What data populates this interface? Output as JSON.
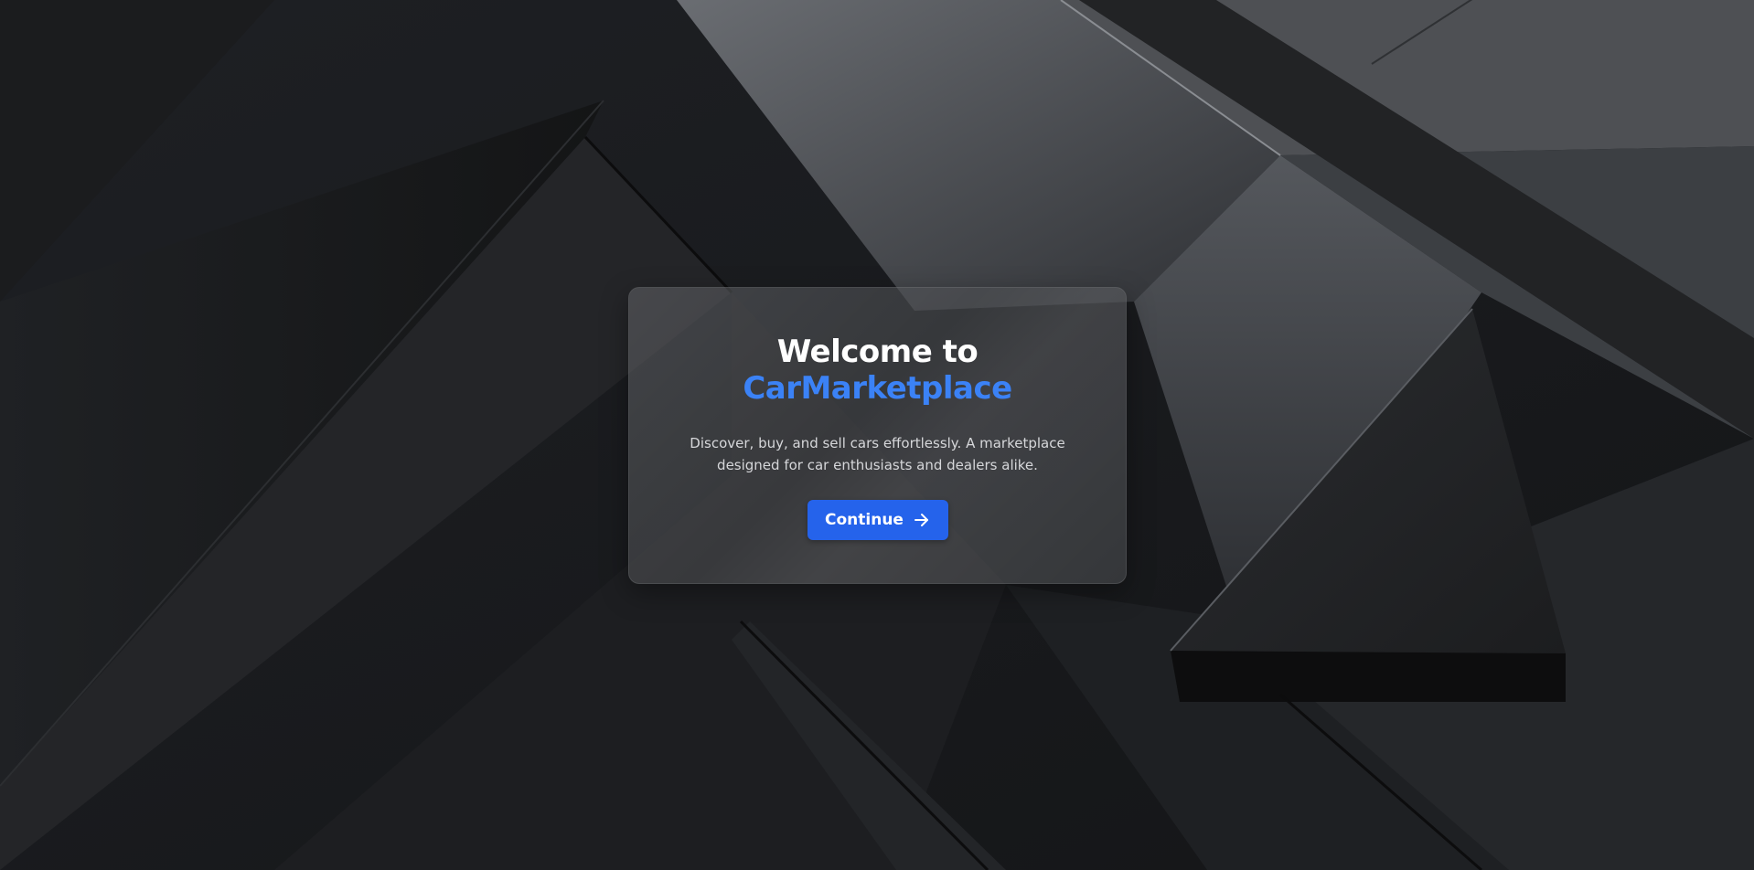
{
  "welcome": {
    "title_line1": "Welcome to",
    "brand": "CarMarketplace",
    "description": "Discover, buy, and sell cars effortlessly. A marketplace designed for car enthusiasts and dealers alike.",
    "continue_label": "Continue",
    "continue_icon": "arrow-right-icon"
  },
  "colors": {
    "brand_accent": "#3b82f6",
    "button_bg": "#2563eb",
    "background": "#1a1b1d"
  }
}
